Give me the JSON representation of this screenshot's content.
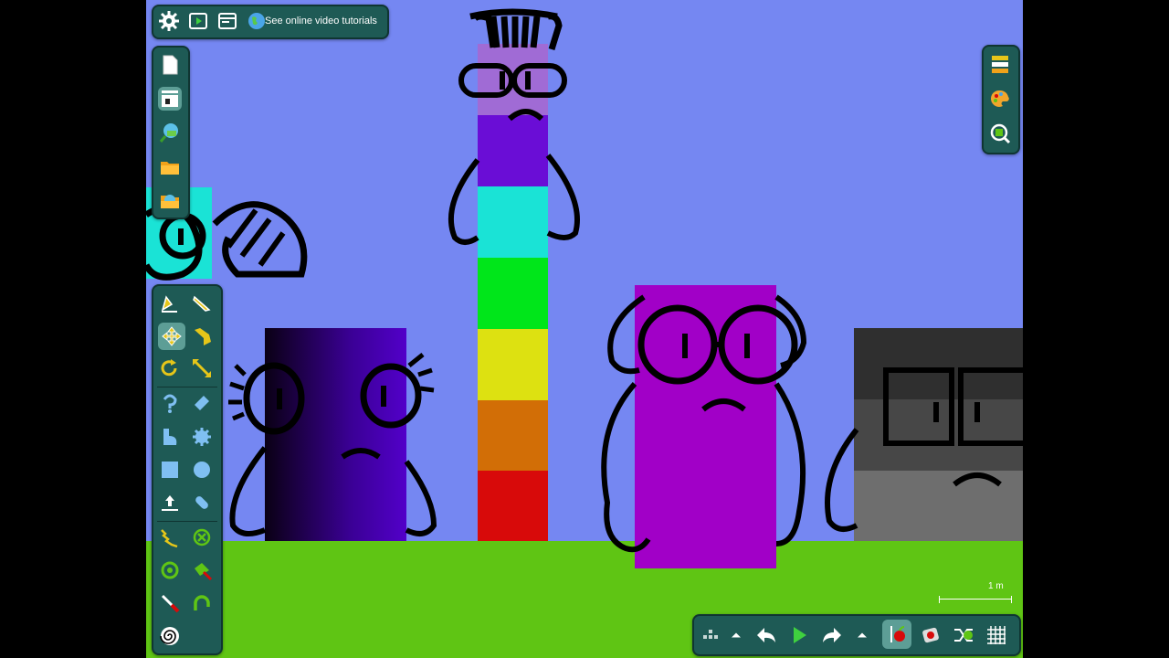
{
  "topbar": {
    "tutorials_label": "See online video tutorials",
    "icons": [
      "gear-icon",
      "play-icon",
      "window-icon",
      "globe-icon"
    ]
  },
  "filebar": {
    "icons": [
      "new-document-icon",
      "film-archive-icon",
      "search-library-icon",
      "open-folder-icon",
      "examples-folder-icon"
    ]
  },
  "toolbox": {
    "selected_tool": "move-icon",
    "rows": [
      [
        "pencil-icon",
        "knife-icon"
      ],
      [
        "move-icon",
        "drag-hand-icon"
      ],
      [
        "rotate-icon",
        "scale-icon"
      ],
      [
        "spring-icon",
        "eraser-icon"
      ],
      [
        "polygon-icon",
        "gear-shape-icon"
      ],
      [
        "square-icon",
        "circle-icon"
      ],
      [
        "pin-icon",
        "thruster-icon"
      ],
      [
        "laser-icon",
        "remove-icon"
      ],
      [
        "fixate-icon",
        "tracer-icon"
      ],
      [
        "brush-icon",
        "hinge-icon"
      ],
      [
        "spiral-icon"
      ]
    ]
  },
  "rightbar": {
    "icons": [
      "layers-icon",
      "palette-icon",
      "zoom-fit-icon"
    ]
  },
  "bottombar": {
    "icons": [
      "grid-dots-icon",
      "menu-up-icon",
      "undo-icon",
      "play-simulation-icon",
      "redo-icon",
      "menu-up-icon",
      "gravity-icon",
      "air-friction-icon",
      "collision-icon",
      "grid-icon"
    ]
  },
  "scale": {
    "label": "1 m"
  },
  "colors": {
    "sky": "#7587f2",
    "ground": "#5fc514",
    "panel": "#1e5a55",
    "accent": "#e6c619"
  },
  "characters": [
    {
      "name": "rainbow-tower",
      "blocks": [
        "#a06bd5",
        "#6a0dd6",
        "#1ae3d6",
        "#00e61a",
        "#dde111",
        "#d26e06",
        "#d80a0a"
      ]
    },
    {
      "name": "indigo-block",
      "colors": [
        "#0a0014",
        "#5200c9"
      ]
    },
    {
      "name": "purple-block",
      "color": "#a100c7"
    },
    {
      "name": "grey-block",
      "colors": [
        "#2f2f2f",
        "#474747",
        "#6e6e6e"
      ]
    },
    {
      "name": "cyan-block",
      "color": "#1ae3d6"
    }
  ]
}
